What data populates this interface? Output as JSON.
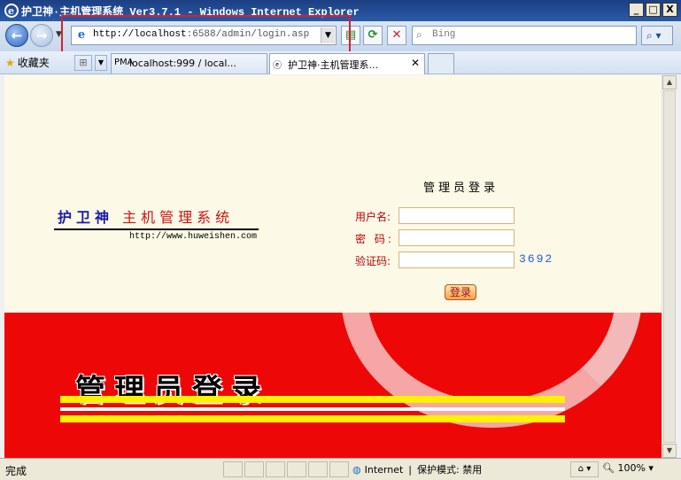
{
  "window": {
    "title": "护卫神·主机管理系统 Ver3.7.1 - Windows Internet Explorer",
    "buttons": {
      "minimize": "_",
      "maximize": "□",
      "close": "X"
    }
  },
  "navbar": {
    "address_host": "http://localhost",
    "address_rest": ":6588/admin/login.asp",
    "search_placeholder": "Bing"
  },
  "favbar": {
    "favorites_label": "收藏夹",
    "tabs": [
      {
        "label": "localhost:999 / local...",
        "icon": "PMA"
      },
      {
        "label": "护卫神·主机管理系...",
        "close": "✕"
      }
    ]
  },
  "page": {
    "brand_blue": "护卫神",
    "brand_red": "主机管理系统",
    "brand_url": "http://www.huweishen.com",
    "login_title": "管理员登录",
    "labels": {
      "username": "用户名:",
      "password": "密 码:",
      "captcha": "验证码:"
    },
    "captcha_value": "3692",
    "login_button": "登录",
    "banner_title": "管理员登录"
  },
  "statusbar": {
    "status": "完成",
    "zone": "Internet",
    "protected_mode": "保护模式: 禁用",
    "zoom": "100%"
  },
  "colors": {
    "banner_red": "#ee0707",
    "stripe_yellow": "#fff200",
    "highlight": "#d9202a",
    "brand_blue": "#1a1aa6",
    "captcha_blue": "#1b5fd6"
  }
}
